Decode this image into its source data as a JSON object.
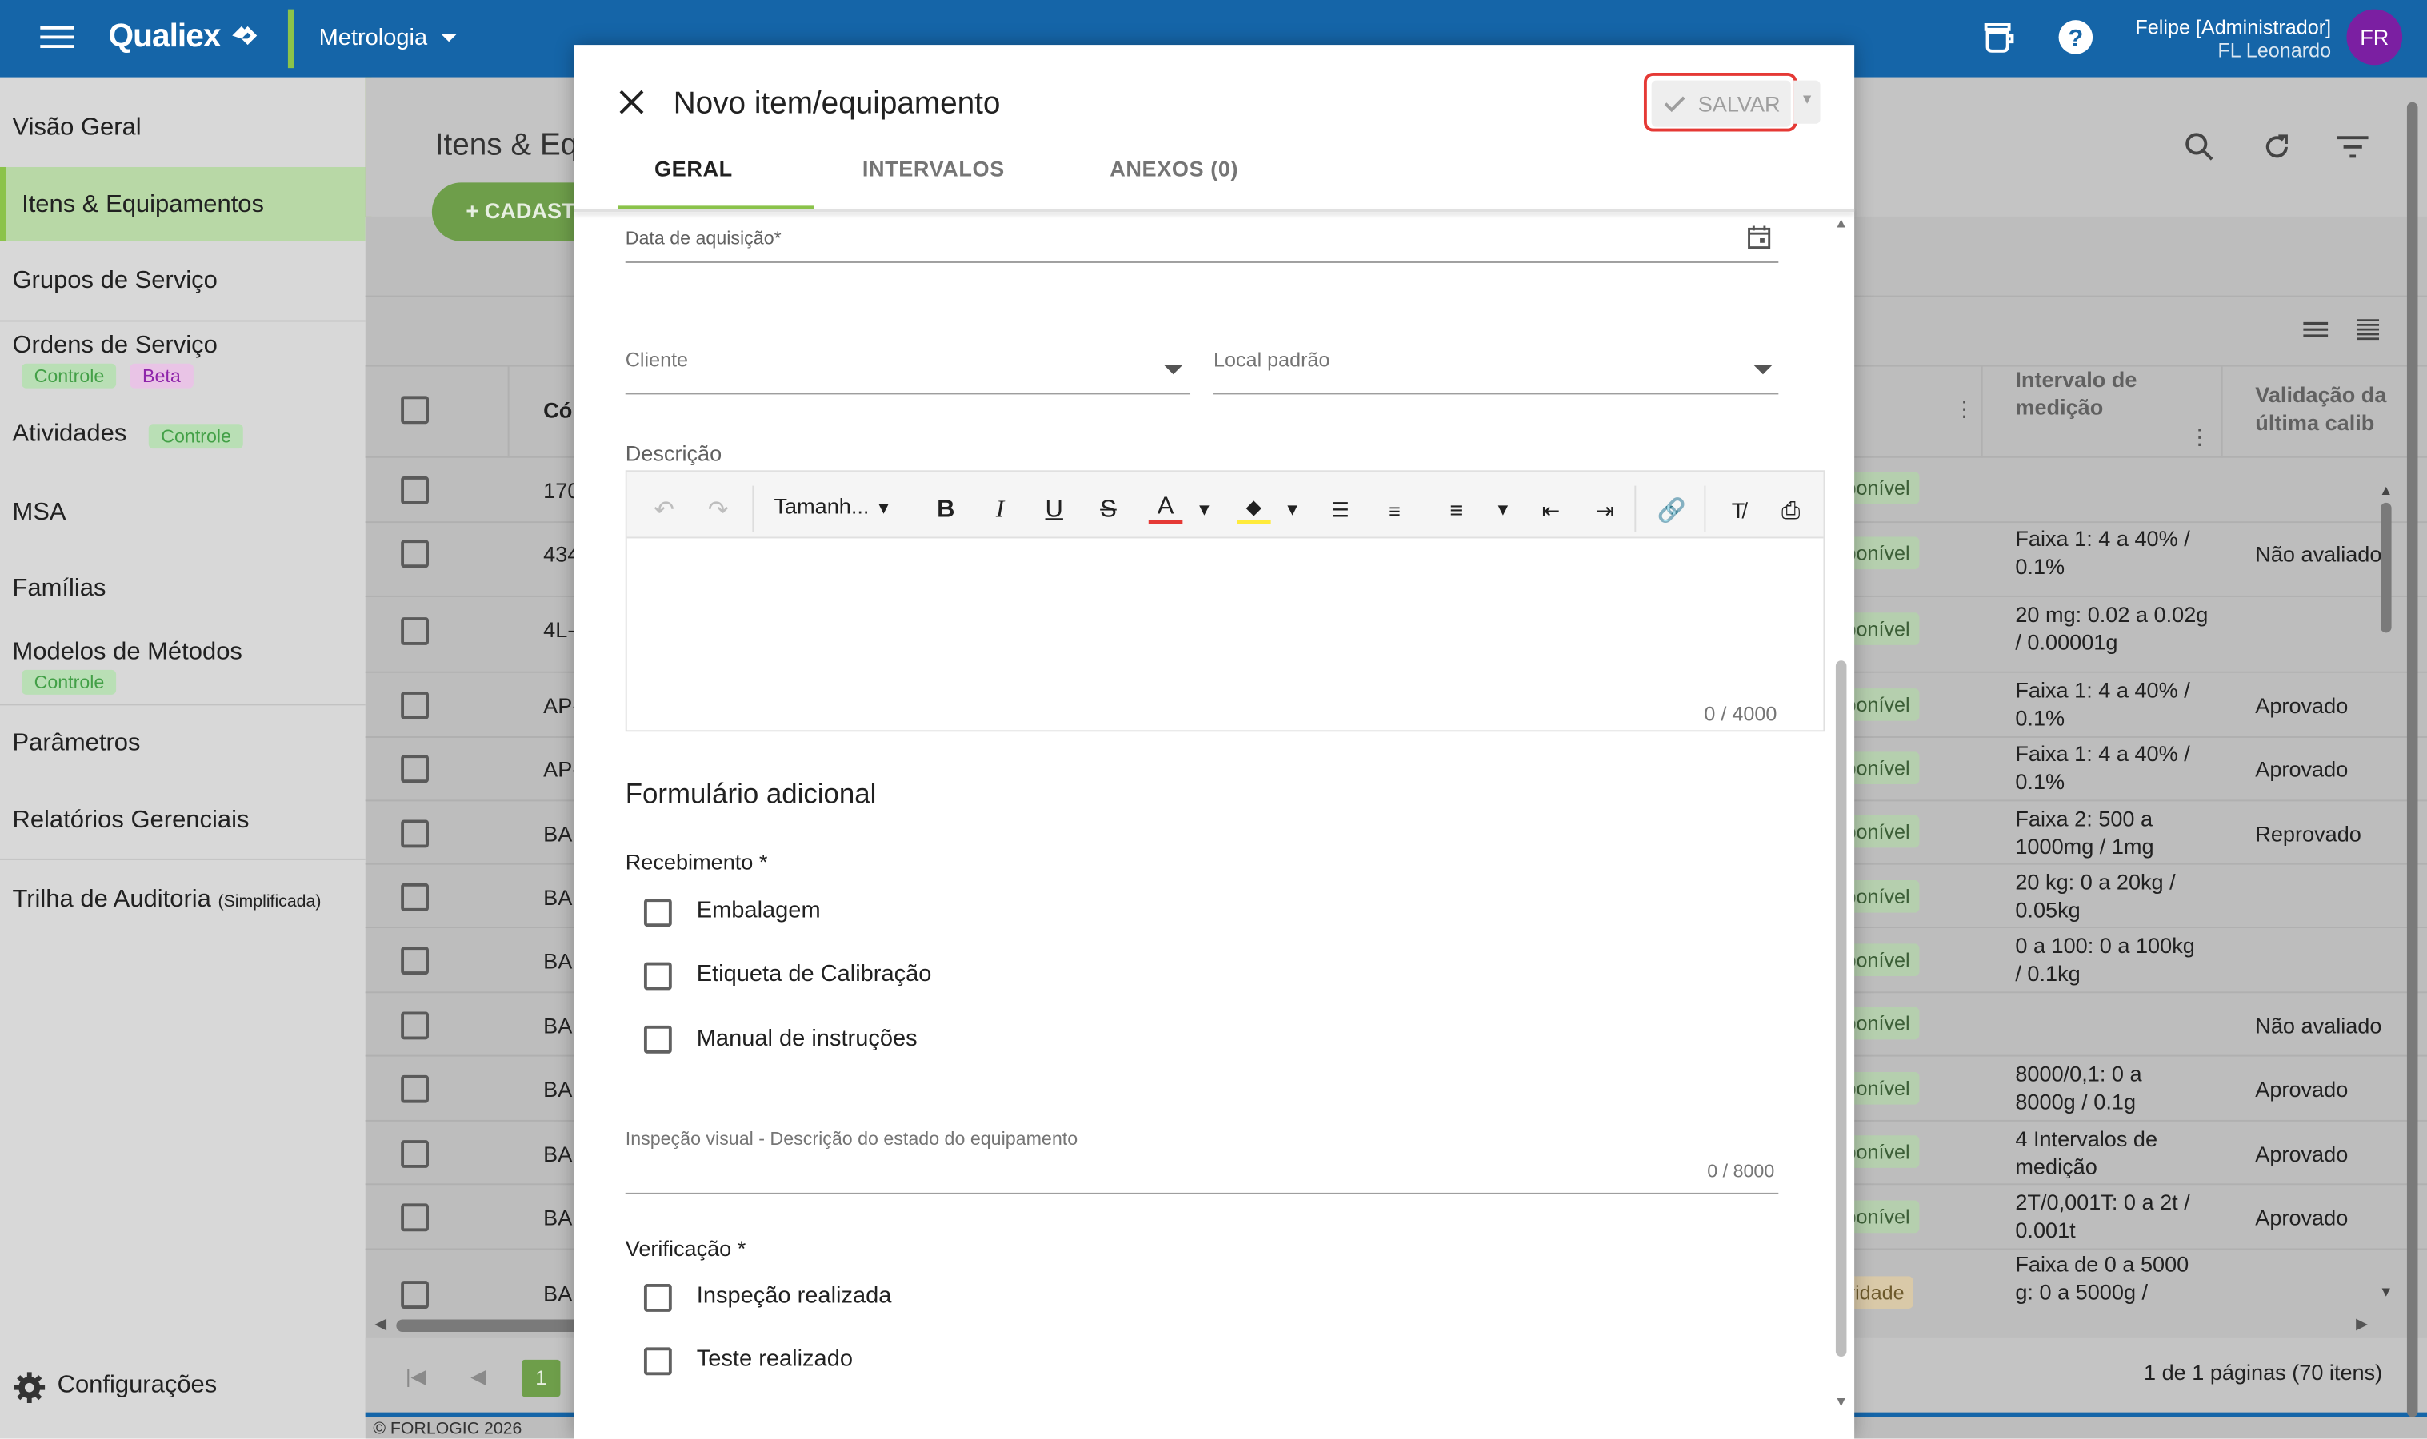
{
  "topbar": {
    "brand": "Qualiex",
    "module": "Metrologia",
    "user_name": "Felipe [Administrador]",
    "user_sub": "FL Leonardo",
    "avatar_initials": "FR",
    "bg_color": "#1565a8"
  },
  "sidebar": {
    "items": [
      {
        "label": "Visão Geral"
      },
      {
        "label": "Itens & Equipamentos"
      },
      {
        "label": "Grupos de Serviço"
      },
      {
        "label": "Ordens de Serviço",
        "tags": [
          "Controle",
          "Beta"
        ]
      },
      {
        "label": "Atividades",
        "tags": [
          "Controle"
        ]
      },
      {
        "label": "MSA"
      },
      {
        "label": "Famílias"
      },
      {
        "label": "Modelos de Métodos",
        "tags": [
          "Controle"
        ]
      },
      {
        "label": "Parâmetros"
      },
      {
        "label": "Relatórios Gerenciais"
      },
      {
        "label": "Trilha de Auditoria",
        "suffix": "(Simplificada)"
      }
    ],
    "settings": "Configurações",
    "footer": "© FORLOGIC 2026"
  },
  "page": {
    "title": "Itens & Eq",
    "add_button": "CADAST",
    "pagination_info": "1 de 1 páginas (70 itens)",
    "current_page": "1"
  },
  "table": {
    "headers": {
      "code": "Có",
      "interval": "Intervalo de medição",
      "validation": "Validação da última calib"
    },
    "rows": [
      {
        "code": "170",
        "status": "ponível",
        "interval": "",
        "validation": ""
      },
      {
        "code": "434",
        "status": "ponível",
        "interval": "Faixa 1: 4 a 40% / 0.1%",
        "validation": "Não avaliado"
      },
      {
        "code": "4L-",
        "status": "ponível",
        "interval": "20 mg: 0.02 a 0.02g / 0.00001g",
        "validation": ""
      },
      {
        "code": "AP-",
        "status": "ponível",
        "interval": "Faixa 1: 4 a 40% / 0.1%",
        "validation": "Aprovado"
      },
      {
        "code": "AP-",
        "status": "ponível",
        "interval": "Faixa 1: 4 a 40% / 0.1%",
        "validation": "Aprovado"
      },
      {
        "code": "BAI",
        "status": "ponível",
        "interval": "Faixa 2: 500 a 1000mg / 1mg",
        "validation": "Reprovado"
      },
      {
        "code": "BAI",
        "status": "ponível",
        "interval": "20 kg: 0 a 20kg / 0.05kg",
        "validation": ""
      },
      {
        "code": "BAI",
        "status": "ponível",
        "interval": "0 a 100: 0 a 100kg / 0.1kg",
        "validation": ""
      },
      {
        "code": "BAI",
        "status": "ponível",
        "interval": "",
        "validation": "Não avaliado"
      },
      {
        "code": "BAI",
        "status": "ponível",
        "interval": "8000/0,1: 0 a 8000g / 0.1g",
        "validation": "Aprovado"
      },
      {
        "code": "BAI",
        "status": "ponível",
        "interval": "4 Intervalos de medição",
        "validation": "Aprovado"
      },
      {
        "code": "BAI",
        "status": "ponível",
        "interval": "2T/0,001T: 0 a 2t / 0.001t",
        "validation": "Aprovado"
      },
      {
        "code": "BAI",
        "status": "vidade",
        "interval": "Faixa de 0 a 5000 g: 0 a 5000g /",
        "validation": ""
      }
    ]
  },
  "dialog": {
    "title": "Novo item/equipamento",
    "save_label": "SALVAR",
    "tabs": [
      "GERAL",
      "INTERVALOS",
      "ANEXOS (0)"
    ],
    "acquisition_date_label": "Data de aquisição*",
    "client_label": "Cliente",
    "location_label": "Local padrão",
    "description_label": "Descrição",
    "font_size_label": "Tamanh...",
    "description_counter": "0 / 4000",
    "additional_form_title": "Formulário adicional",
    "receipt_label": "Recebimento *",
    "receipt_options": [
      "Embalagem",
      "Etiqueta de Calibração",
      "Manual de instruções"
    ],
    "visual_inspection_label": "Inspeção visual - Descrição do estado do equipamento",
    "visual_inspection_counter": "0 / 8000",
    "verification_label": "Verificação *",
    "verification_options": [
      "Inspeção realizada",
      "Teste realizado"
    ],
    "accent_color": "#8bc34a",
    "highlight_color": "#e53935"
  }
}
